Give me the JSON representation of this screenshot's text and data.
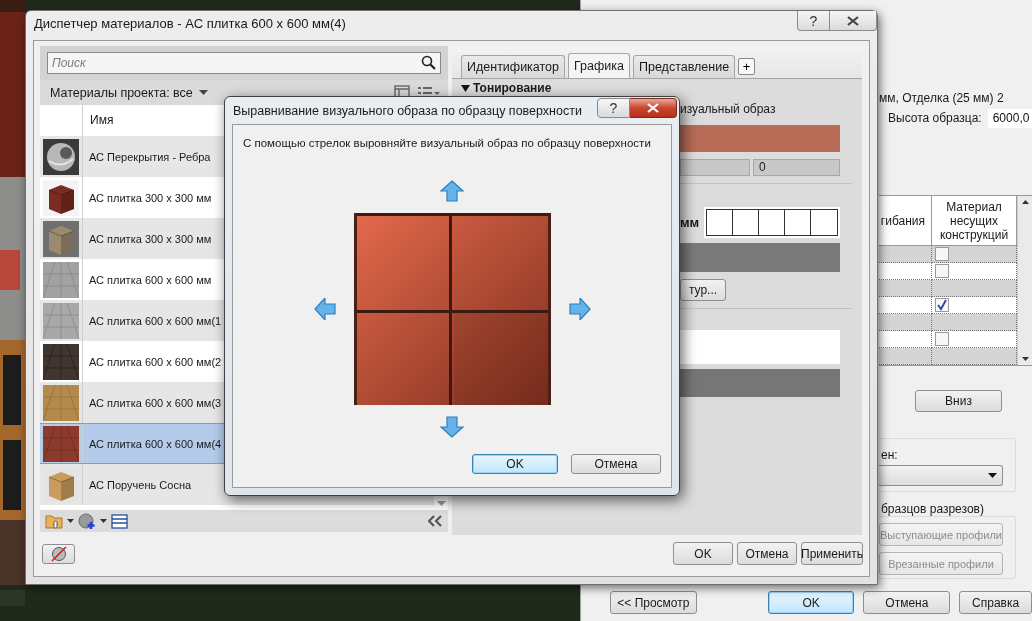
{
  "background_dialog": {
    "layer_text": "мм, Отделка (25 мм) 2",
    "sample_height": {
      "label": "Высота образца:",
      "value": "6000,0"
    },
    "table": {
      "columns": [
        "гибания",
        "Материал несущих конструкций"
      ],
      "rows": [
        {
          "kind": "checkbox",
          "checked": false
        },
        {
          "kind": "checkbox",
          "checked": false
        },
        {
          "kind": "blank"
        },
        {
          "kind": "checkbox",
          "checked": true
        },
        {
          "kind": "blank"
        },
        {
          "kind": "checkbox",
          "checked": false
        },
        {
          "kind": "blank"
        }
      ]
    },
    "move_down_button": "Вниз",
    "dropdown_label": "ен:",
    "section_group": {
      "label": "бразцов разрезов)",
      "buttons": [
        {
          "label": "Выступающие профили",
          "disabled": true
        },
        {
          "label": "Врезанные профили",
          "disabled": true
        }
      ]
    },
    "buttons": [
      {
        "label": "<< Просмотр",
        "default": false
      },
      {
        "label": "OK",
        "default": true
      },
      {
        "label": "Отмена",
        "default": false
      },
      {
        "label": "Справка",
        "default": false
      }
    ]
  },
  "material_manager": {
    "title": "Диспетчер материалов - АС плитка 600 x 600 мм(4)",
    "help_button": "?",
    "search": {
      "placeholder": "Поиск"
    },
    "filter": "Материалы проекта: все",
    "list": {
      "column": "Имя",
      "items": [
        {
          "name": "АС Перекрытия - Ребра",
          "selected": false
        },
        {
          "name": "АС плитка 300 x 300 мм",
          "selected": false
        },
        {
          "name": "АС плитка 300 x 300 мм",
          "selected": false
        },
        {
          "name": "АС плитка 600 x 600 мм",
          "selected": false
        },
        {
          "name": "АС плитка 600 x 600 мм(1",
          "selected": false
        },
        {
          "name": "АС плитка 600 x 600 мм(2",
          "selected": false
        },
        {
          "name": "АС плитка 600 x 600 мм(3",
          "selected": false
        },
        {
          "name": "АС плитка 600 x 600 мм(4",
          "selected": true
        },
        {
          "name": "АС Поручень Сосна",
          "selected": false
        }
      ]
    },
    "tabs": [
      {
        "label": "Идентификатор",
        "selected": false
      },
      {
        "label": "Графика",
        "selected": true
      },
      {
        "label": "Представление",
        "selected": false
      }
    ],
    "add_tab": "+",
    "section": {
      "title": "Тонирование",
      "expanded": true
    },
    "appearance_label": "изуальный образ",
    "transparency_value": "0",
    "pattern_label": "мм",
    "pattern_button": "тур...",
    "buttons": [
      "OK",
      "Отмена",
      "Применить"
    ]
  },
  "align_dialog": {
    "title": "Выравнивание визуального образа по образцу поверхности",
    "help_button": "?",
    "instruction": "С помощью стрелок выровняйте визуальный образ по образцу поверхности",
    "buttons": [
      {
        "label": "OK",
        "default": true
      },
      {
        "label": "Отмена",
        "default": false
      }
    ]
  }
}
